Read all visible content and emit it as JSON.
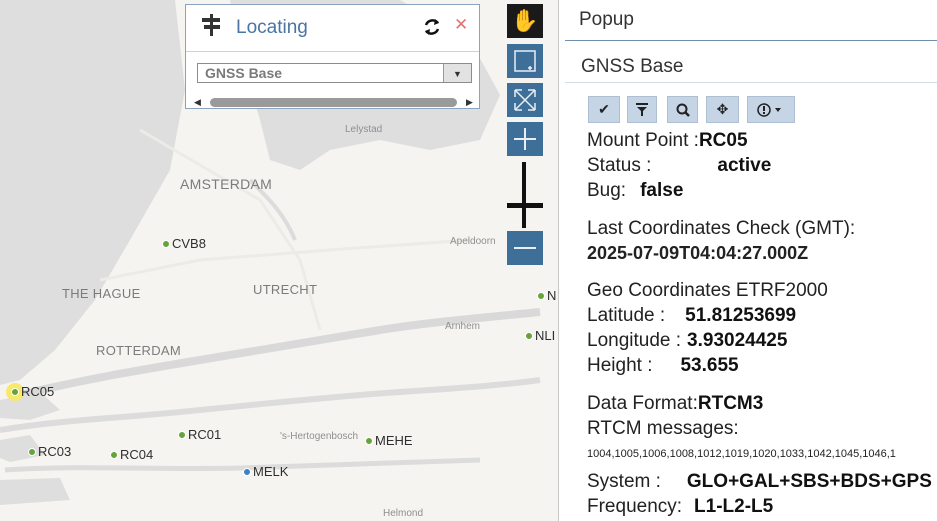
{
  "map": {
    "labels": {
      "lelystad": "Lelystad",
      "amsterdam": "AMSTERDAM",
      "the_hague": "THE HAGUE",
      "utrecht": "UTRECHT",
      "rotterdam": "ROTTERDAM",
      "apeldoorn": "Apeldoorn",
      "arnhem": "Arnhem",
      "s_hertogenbosch": "'s-Hertogenbosch",
      "helmond": "Helmond"
    },
    "stations": {
      "cvb8": "CVB8",
      "rc05": "RC05",
      "rc03": "RC03",
      "rc04": "RC04",
      "rc01": "RC01",
      "mehe": "MEHE",
      "melk": "MELK",
      "partial_n": "N",
      "partial_nl": "NLI"
    },
    "colors": {
      "land": "#f6f4f0",
      "water": "#dedede",
      "station": "#66a33a",
      "station_blue": "#3d7fbf",
      "highlight": "#f6e96b"
    }
  },
  "locating": {
    "title": "Locating",
    "select_value": "GNSS Base",
    "icons": {
      "sign": "signpost-icon",
      "refresh": "refresh-icon",
      "close": "close-icon"
    }
  },
  "toolbar": {
    "icons": [
      "hand-pan-icon",
      "zoom-box-icon",
      "fullscreen-icon",
      "zoom-in-icon",
      "zoom-out-icon"
    ]
  },
  "popup": {
    "title": "Popup",
    "subtitle": "GNSS Base",
    "buttons": [
      "check-icon",
      "filter-icon",
      "zoom-icon",
      "locate-icon",
      "info-dropdown-icon"
    ],
    "mount_point_label": "Mount Point :",
    "mount_point": "RC05",
    "status_label": "Status :",
    "status": "active",
    "bug_label": "Bug:",
    "bug": "false",
    "last_check_label": "Last Coordinates Check (GMT):",
    "last_check": "2025-07-09T04:04:27.000Z",
    "geo_label": "Geo Coordinates ETRF2000",
    "latitude_label": "Latitude :",
    "latitude": "51.81253699",
    "longitude_label": "Longitude :",
    "longitude": "3.93024425",
    "height_label": "Height :",
    "height": "53.655",
    "data_format_label": "Data Format:",
    "data_format": "RTCM3",
    "rtcm_label": "RTCM messages:",
    "rtcm_messages": "1004,1005,1006,1008,1012,1019,1020,1033,1042,1045,1046,1",
    "system_label": "System :",
    "system": "GLO+GAL+SBS+BDS+GPS",
    "frequency_label": "Frequency:",
    "frequency": "L1-L2-L5"
  }
}
